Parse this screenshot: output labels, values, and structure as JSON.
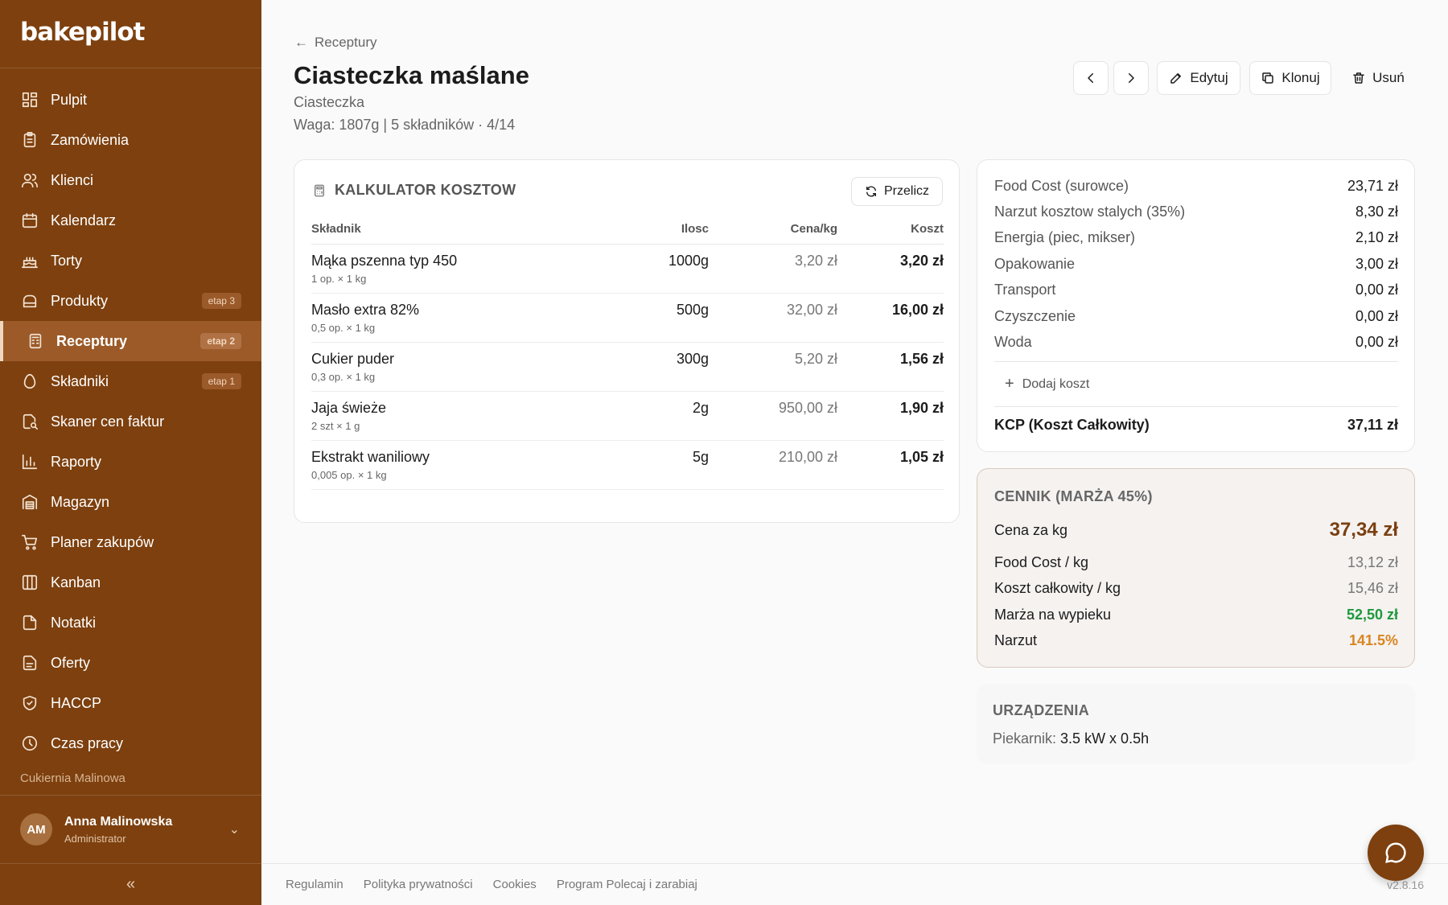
{
  "app": {
    "logo": "bakepilot"
  },
  "sidebar": {
    "items": [
      {
        "label": "Pulpit",
        "icon": "dashboard-icon"
      },
      {
        "label": "Zamówienia",
        "icon": "clipboard-icon"
      },
      {
        "label": "Klienci",
        "icon": "users-icon"
      },
      {
        "label": "Kalendarz",
        "icon": "calendar-icon"
      },
      {
        "label": "Torty",
        "icon": "cake-icon"
      },
      {
        "label": "Produkty",
        "icon": "bread-icon",
        "badge": "etap 3"
      },
      {
        "label": "Receptury",
        "icon": "recipe-icon",
        "badge": "etap 2",
        "active": true
      },
      {
        "label": "Składniki",
        "icon": "egg-icon",
        "badge": "etap 1"
      },
      {
        "label": "Skaner cen faktur",
        "icon": "scan-icon"
      },
      {
        "label": "Raporty",
        "icon": "chart-icon"
      },
      {
        "label": "Magazyn",
        "icon": "warehouse-icon"
      },
      {
        "label": "Planer zakupów",
        "icon": "cart-icon"
      },
      {
        "label": "Kanban",
        "icon": "kanban-icon"
      },
      {
        "label": "Notatki",
        "icon": "note-icon"
      },
      {
        "label": "Oferty",
        "icon": "document-icon"
      },
      {
        "label": "HACCP",
        "icon": "shield-icon"
      },
      {
        "label": "Czas pracy",
        "icon": "clock-icon"
      }
    ],
    "org": "Cukiernia Malinowa",
    "user": {
      "initials": "AM",
      "name": "Anna Malinowska",
      "role": "Administrator"
    },
    "collapse": "«"
  },
  "header": {
    "back": "Receptury",
    "title": "Ciasteczka maślane",
    "category": "Ciasteczka",
    "meta": "Waga: 1807g | 5 składników · 4/14",
    "buttons": {
      "edit": "Edytuj",
      "clone": "Klonuj",
      "delete": "Usuń"
    }
  },
  "calculator": {
    "title": "KALKULATOR KOSZTOW",
    "recalc": "Przelicz",
    "columns": [
      "Składnik",
      "Ilosc",
      "Cena/kg",
      "Koszt"
    ],
    "rows": [
      {
        "name": "Mąka pszenna typ 450",
        "sub": "1 op. × 1 kg",
        "qty": "1000g",
        "price": "3,20 zł",
        "cost": "3,20 zł"
      },
      {
        "name": "Masło extra 82%",
        "sub": "0,5 op. × 1 kg",
        "qty": "500g",
        "price": "32,00 zł",
        "cost": "16,00 zł"
      },
      {
        "name": "Cukier puder",
        "sub": "0,3 op. × 1 kg",
        "qty": "300g",
        "price": "5,20 zł",
        "cost": "1,56 zł"
      },
      {
        "name": "Jaja świeże",
        "sub": "2 szt × 1 g",
        "qty": "2g",
        "price": "950,00 zł",
        "cost": "1,90 zł"
      },
      {
        "name": "Ekstrakt waniliowy",
        "sub": "0,005 op. × 1 kg",
        "qty": "5g",
        "price": "210,00 zł",
        "cost": "1,05 zł"
      }
    ]
  },
  "costs": {
    "rows": [
      {
        "label": "Food Cost (surowce)",
        "value": "23,71 zł"
      },
      {
        "label": "Narzut kosztow stalych (35%)",
        "value": "8,30 zł"
      },
      {
        "label": "Energia (piec, mikser)",
        "value": "2,10 zł"
      },
      {
        "label": "Opakowanie",
        "value": "3,00 zł"
      },
      {
        "label": "Transport",
        "value": "0,00 zł"
      },
      {
        "label": "Czyszczenie",
        "value": "0,00 zł"
      },
      {
        "label": "Woda",
        "value": "0,00 zł"
      }
    ],
    "add": "Dodaj koszt",
    "total": {
      "label": "KCP (Koszt Całkowity)",
      "value": "37,11 zł"
    }
  },
  "pricing": {
    "title": "CENNIK (MARŻA 45%)",
    "price_per_kg": {
      "label": "Cena za kg",
      "value": "37,34 zł"
    },
    "rows": [
      {
        "label": "Food Cost / kg",
        "value": "13,12 zł"
      },
      {
        "label": "Koszt całkowity / kg",
        "value": "15,46 zł"
      },
      {
        "label": "Marża na wypieku",
        "value": "52,50 zł"
      },
      {
        "label": "Narzut",
        "value": "141.5%"
      }
    ],
    "colors": {
      "margin": "#1e9a3c",
      "markup": "#d98621",
      "price": "#7a3f10"
    }
  },
  "devices": {
    "title": "URZĄDZENIA",
    "label": "Piekarnik:",
    "value": "3.5 kW x 0.5h"
  },
  "footer": {
    "links": [
      "Regulamin",
      "Polityka prywatności",
      "Cookies",
      "Program Polecaj i zarabiaj"
    ],
    "version": "v2.8.16"
  },
  "colors": {
    "sidebar": "#7d400e",
    "accent": "#7a3f10"
  }
}
